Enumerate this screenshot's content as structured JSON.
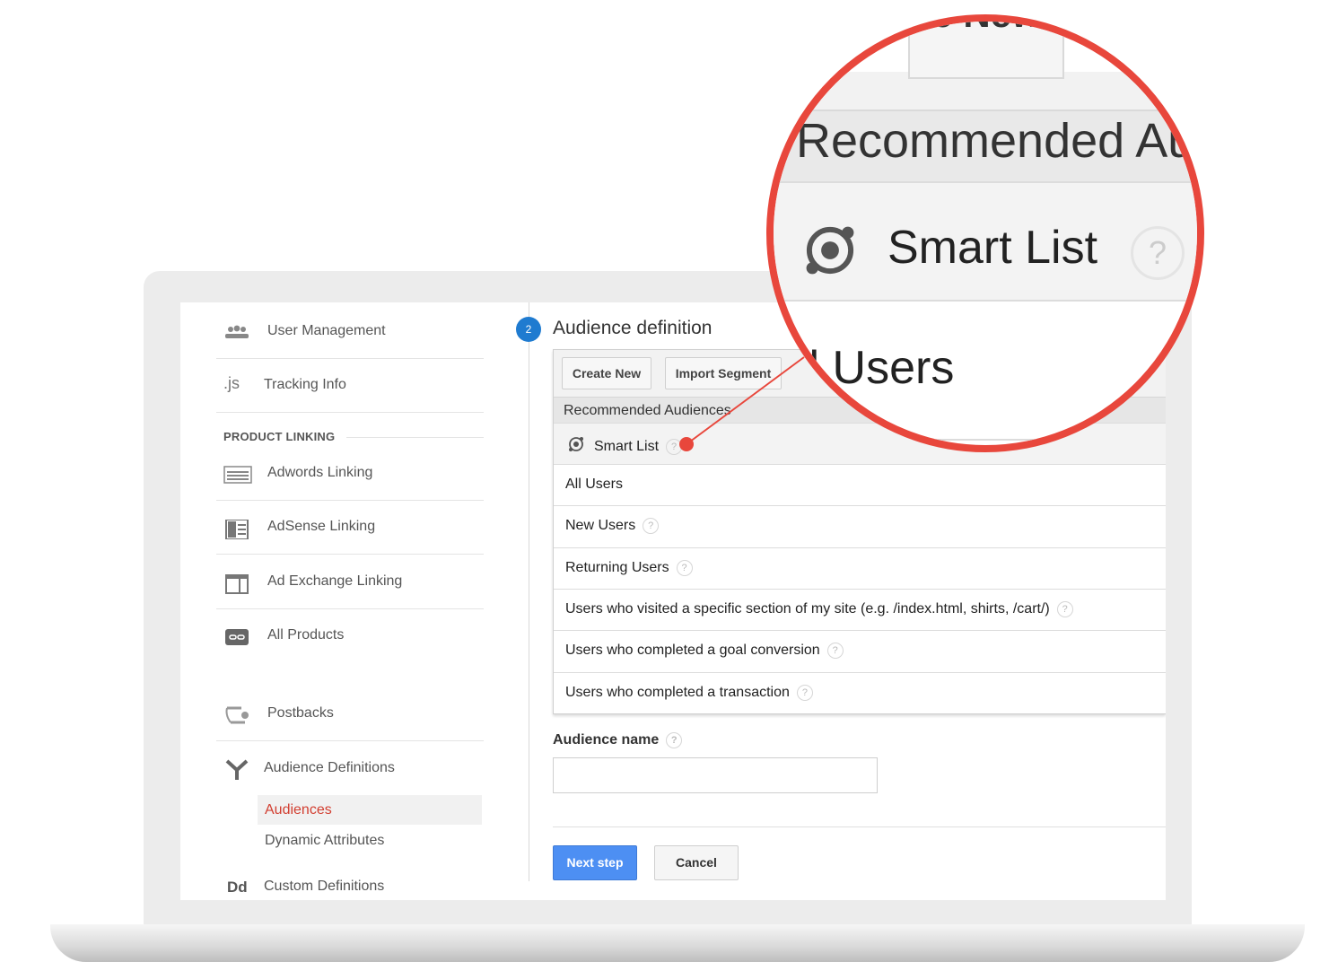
{
  "sidebar": {
    "items": [
      {
        "label": "User Management",
        "icon": "users-icon"
      },
      {
        "label": "Tracking Info",
        "icon": "js-icon"
      },
      {
        "label": "Adwords Linking",
        "icon": "adwords-icon"
      },
      {
        "label": "AdSense Linking",
        "icon": "adsense-icon"
      },
      {
        "label": "Ad Exchange Linking",
        "icon": "ad-exchange-icon"
      },
      {
        "label": "All Products",
        "icon": "link-icon"
      },
      {
        "label": "Postbacks",
        "icon": "postbacks-icon"
      },
      {
        "label": "Audience Definitions",
        "icon": "audience-icon"
      },
      {
        "label": "Custom Definitions",
        "icon": "dd-icon"
      }
    ],
    "section_header": "PRODUCT LINKING",
    "js_glyph": ".js",
    "dd_glyph": "Dd",
    "subitems": [
      {
        "label": "Audiences",
        "active": true
      },
      {
        "label": "Dynamic Attributes",
        "active": false
      }
    ]
  },
  "main": {
    "step_number": "2",
    "title": "Audience definition",
    "toolbar": {
      "create_new": "Create New",
      "import_segment": "Import Segment"
    },
    "recommended_header": "Recommended Audiences",
    "rows": [
      {
        "label": "Smart List",
        "help": true
      },
      {
        "label": "All Users",
        "help": false
      },
      {
        "label": "New Users",
        "help": true
      },
      {
        "label": "Returning Users",
        "help": true
      },
      {
        "label": "Users who visited a specific section of my site (e.g. /index.html, shirts, /cart/)",
        "help": true
      },
      {
        "label": "Users who completed a goal conversion",
        "help": true
      },
      {
        "label": "Users who completed a transaction",
        "help": true
      }
    ],
    "audience_name_label": "Audience name",
    "audience_name_value": "",
    "next_label": "Next step",
    "cancel_label": "Cancel",
    "help_glyph": "?"
  },
  "magnifier": {
    "button_fragment": "e New",
    "recommended_fragment": "Recommended Au",
    "smart_list": "Smart List",
    "all_users_fragment": "ll Users"
  },
  "colors": {
    "accent_red": "#e8473c",
    "primary_blue": "#4d8ff3",
    "active_red": "#d23f31",
    "step_blue": "#1f7bd0"
  }
}
